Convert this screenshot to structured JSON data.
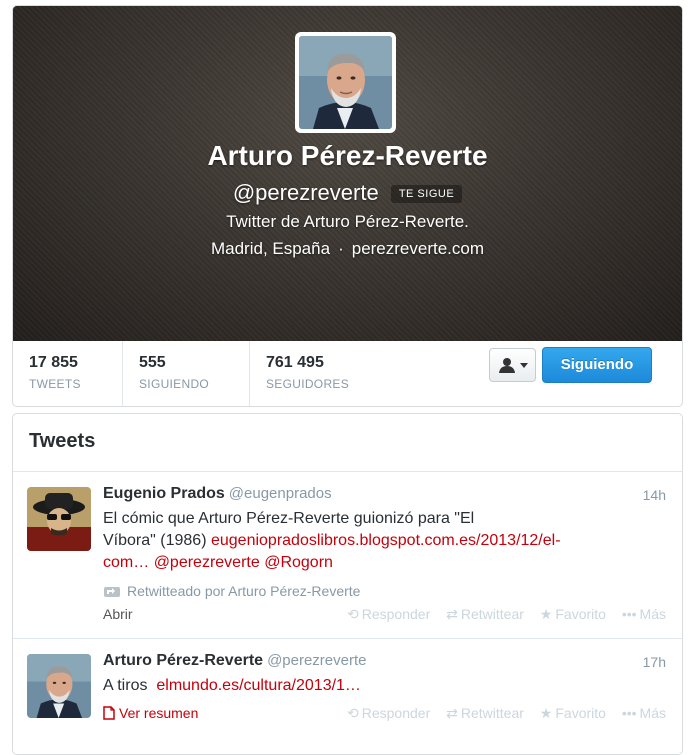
{
  "profile": {
    "name": "Arturo Pérez-Reverte",
    "handle": "@perezreverte",
    "follows_badge": "TE SIGUE",
    "bio": "Twitter de Arturo Pérez-Reverte.",
    "location": "Madrid, España",
    "separator": "·",
    "website": "perezreverte.com",
    "hero_color": "#2f2b28"
  },
  "stats": {
    "tweets": {
      "value": "17 855",
      "label": "TWEETS"
    },
    "following": {
      "value": "555",
      "label": "SIGUIENDO"
    },
    "followers": {
      "value": "761 495",
      "label": "SEGUIDORES"
    }
  },
  "actions_bar": {
    "user_menu_icon": "user-dropdown-icon",
    "following_button": "Siguiendo",
    "following_color": "#2aa0e8"
  },
  "timeline": {
    "title": "Tweets",
    "link_color": "#c5000b",
    "tweets": [
      {
        "fullname": "Eugenio Prados",
        "screenname": "@eugenprados",
        "time": "14h",
        "text_line1": "El cómic que Arturo Pérez-Reverte guionizó para \"El",
        "text_line2a": "Víbora\" (1986) ",
        "link1": "eugeniopradoslibros.blogspot.com.es/2013/12/el-",
        "link1b": "com…",
        "mention1": "@perezreverte",
        "mention2": "@Rogorn",
        "retweet_context": "Retwitteado por Arturo Pérez-Reverte",
        "expand": "Abrir",
        "reply": "Responder",
        "retweet": "Retwittear",
        "favorite": "Favorito",
        "more": "Más"
      },
      {
        "fullname": "Arturo Pérez-Reverte",
        "screenname": "@perezreverte",
        "time": "17h",
        "text": "A tiros",
        "link": "elmundo.es/cultura/2013/1…",
        "summary": "Ver resumen",
        "reply": "Responder",
        "retweet": "Retwittear",
        "favorite": "Favorito",
        "more": "Más"
      }
    ]
  }
}
